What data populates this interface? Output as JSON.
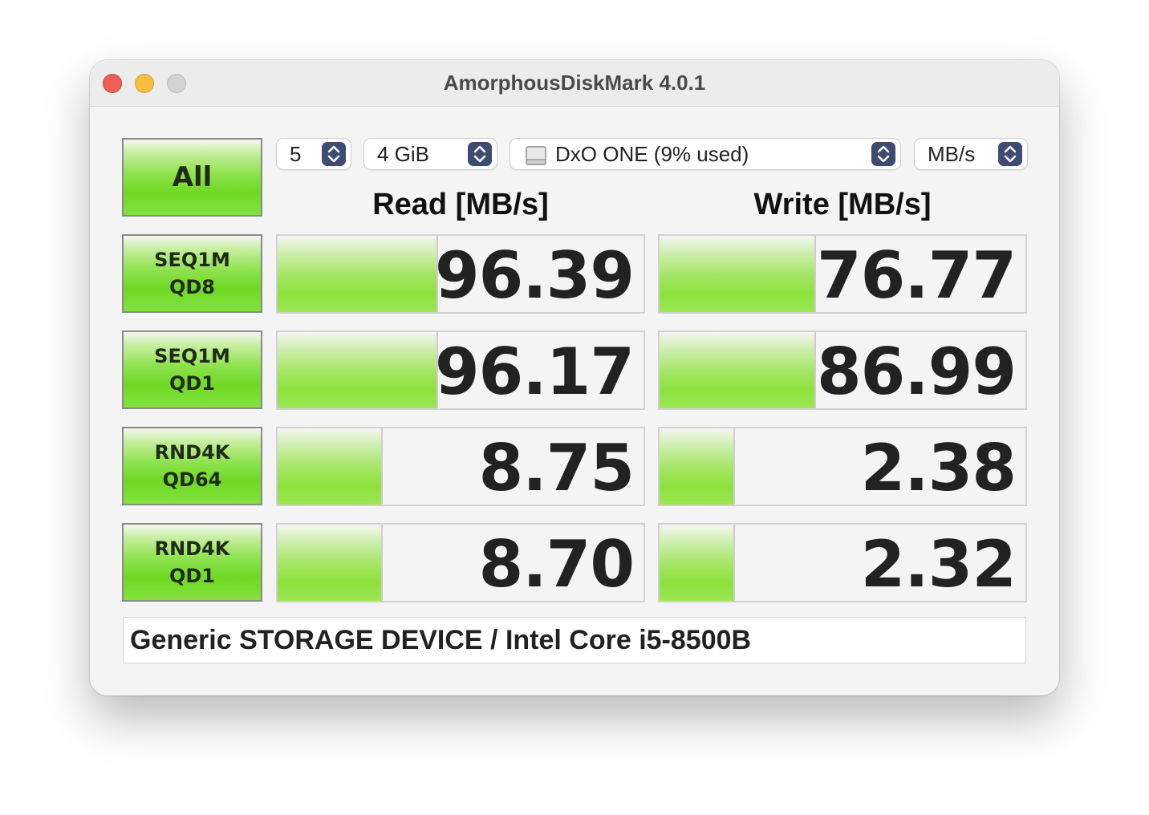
{
  "window": {
    "title": "AmorphousDiskMark 4.0.1"
  },
  "controls": {
    "count": "5",
    "size": "4 GiB",
    "disk": "DxO ONE (9% used)",
    "unit": "MB/s"
  },
  "headers": {
    "read": "Read [MB/s]",
    "write": "Write [MB/s]"
  },
  "all_label": "All",
  "tests": [
    {
      "line1": "SEQ1M",
      "line2": "QD8",
      "read": "96.39",
      "write": "76.77",
      "read_fill": 0.43,
      "write_fill": 0.42
    },
    {
      "line1": "SEQ1M",
      "line2": "QD1",
      "read": "96.17",
      "write": "86.99",
      "read_fill": 0.43,
      "write_fill": 0.42
    },
    {
      "line1": "RND4K",
      "line2": "QD64",
      "read": "8.75",
      "write": "2.38",
      "read_fill": 0.28,
      "write_fill": 0.2
    },
    {
      "line1": "RND4K",
      "line2": "QD1",
      "read": "8.70",
      "write": "2.32",
      "read_fill": 0.28,
      "write_fill": 0.2
    }
  ],
  "comment": "Generic STORAGE DEVICE / Intel Core i5-8500B"
}
